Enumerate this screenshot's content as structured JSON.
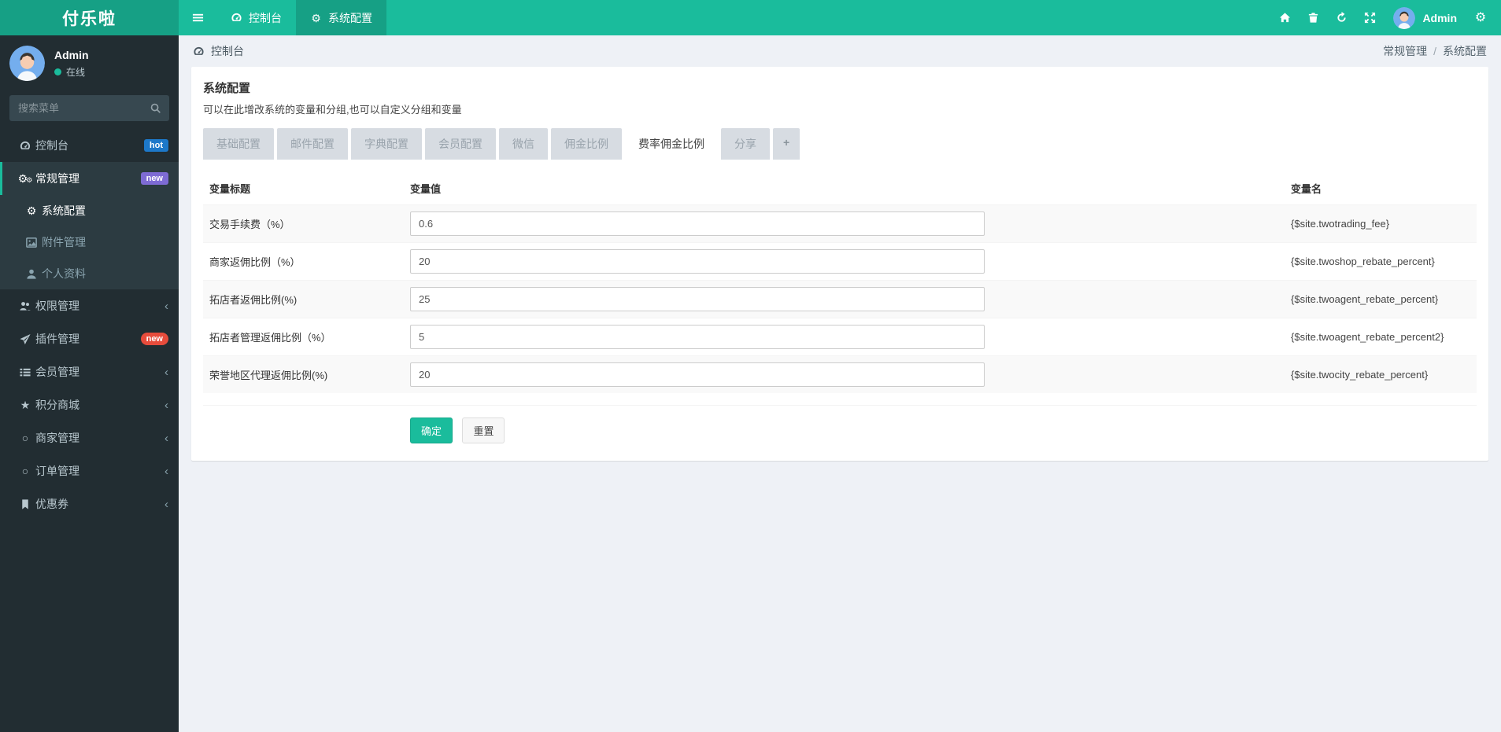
{
  "app": {
    "title": "付乐啦"
  },
  "topnav": {
    "items": [
      {
        "label": "控制台",
        "icon": "dashboard-icon",
        "active": false
      },
      {
        "label": "系统配置",
        "icon": "gear-icon",
        "active": true
      }
    ],
    "right_icons": [
      "home-icon",
      "trash-icon",
      "clear-cache-icon",
      "fullscreen-icon",
      "settings-icon"
    ],
    "admin_label": "Admin"
  },
  "sidebar": {
    "user": {
      "name": "Admin",
      "status": "在线"
    },
    "search_placeholder": "搜索菜单",
    "items": [
      {
        "label": "控制台",
        "icon": "dashboard-icon",
        "badge": "hot"
      },
      {
        "label": "常规管理",
        "icon": "cogs-icon",
        "badge": "new",
        "active": true
      },
      {
        "label": "系统配置",
        "icon": "gear-icon",
        "submenu": true,
        "active": true
      },
      {
        "label": "附件管理",
        "icon": "image-icon",
        "submenu": true
      },
      {
        "label": "个人资料",
        "icon": "user-icon",
        "submenu": true
      },
      {
        "label": "权限管理",
        "icon": "users-icon",
        "chevron": "‹"
      },
      {
        "label": "插件管理",
        "icon": "paper-plane-icon",
        "badge": "new"
      },
      {
        "label": "会员管理",
        "icon": "list-icon",
        "chevron": "‹"
      },
      {
        "label": "积分商城",
        "icon": "star-icon",
        "chevron": "‹"
      },
      {
        "label": "商家管理",
        "icon": "circle-icon",
        "chevron": "‹"
      },
      {
        "label": "订单管理",
        "icon": "circle-icon",
        "chevron": "‹"
      },
      {
        "label": "优惠券",
        "icon": "bookmark-icon",
        "chevron": "‹"
      }
    ]
  },
  "breadcrumb": {
    "left_icon": "dashboard-icon",
    "left_label": "控制台",
    "right": [
      "常规管理",
      "系统配置"
    ],
    "separator": "/"
  },
  "config": {
    "title": "系统配置",
    "subtitle": "可以在此增改系统的变量和分组,也可以自定义分组和变量",
    "tabs": {
      "items": [
        "基础配置",
        "邮件配置",
        "字典配置",
        "会员配置",
        "微信",
        "佣金比例",
        "费率佣金比例",
        "分享",
        "+"
      ],
      "active_index": 6
    },
    "columns": [
      "变量标题",
      "变量值",
      "变量名"
    ],
    "rows": [
      {
        "label": "交易手续费（%）",
        "value": "0.6",
        "var_name": "{$site.twotrading_fee}"
      },
      {
        "label": "商家返佣比例（%）",
        "value": "20",
        "var_name": "{$site.twoshop_rebate_percent}"
      },
      {
        "label": "拓店者返佣比例(%)",
        "value": "25",
        "var_name": "{$site.twoagent_rebate_percent}"
      },
      {
        "label": "拓店者管理返佣比例（%）",
        "value": "5",
        "var_name": "{$site.twoagent_rebate_percent2}"
      },
      {
        "label": "荣誉地区代理返佣比例(%)",
        "value": "20",
        "var_name": "{$site.twocity_rebate_percent}"
      }
    ],
    "buttons": {
      "submit": "确定",
      "reset": "重置"
    }
  },
  "theme": {
    "accent": "#1abc9c",
    "accent_dark": "#16a085",
    "sidebar_bg": "#222d32",
    "submenu_bg": "#2c3b41",
    "content_bg": "#eef1f6",
    "badge_hot_color": "#1d78c9",
    "badge_new_purple_color": "#7e6bd4",
    "badge_new_red_color": "#e74c3c"
  }
}
